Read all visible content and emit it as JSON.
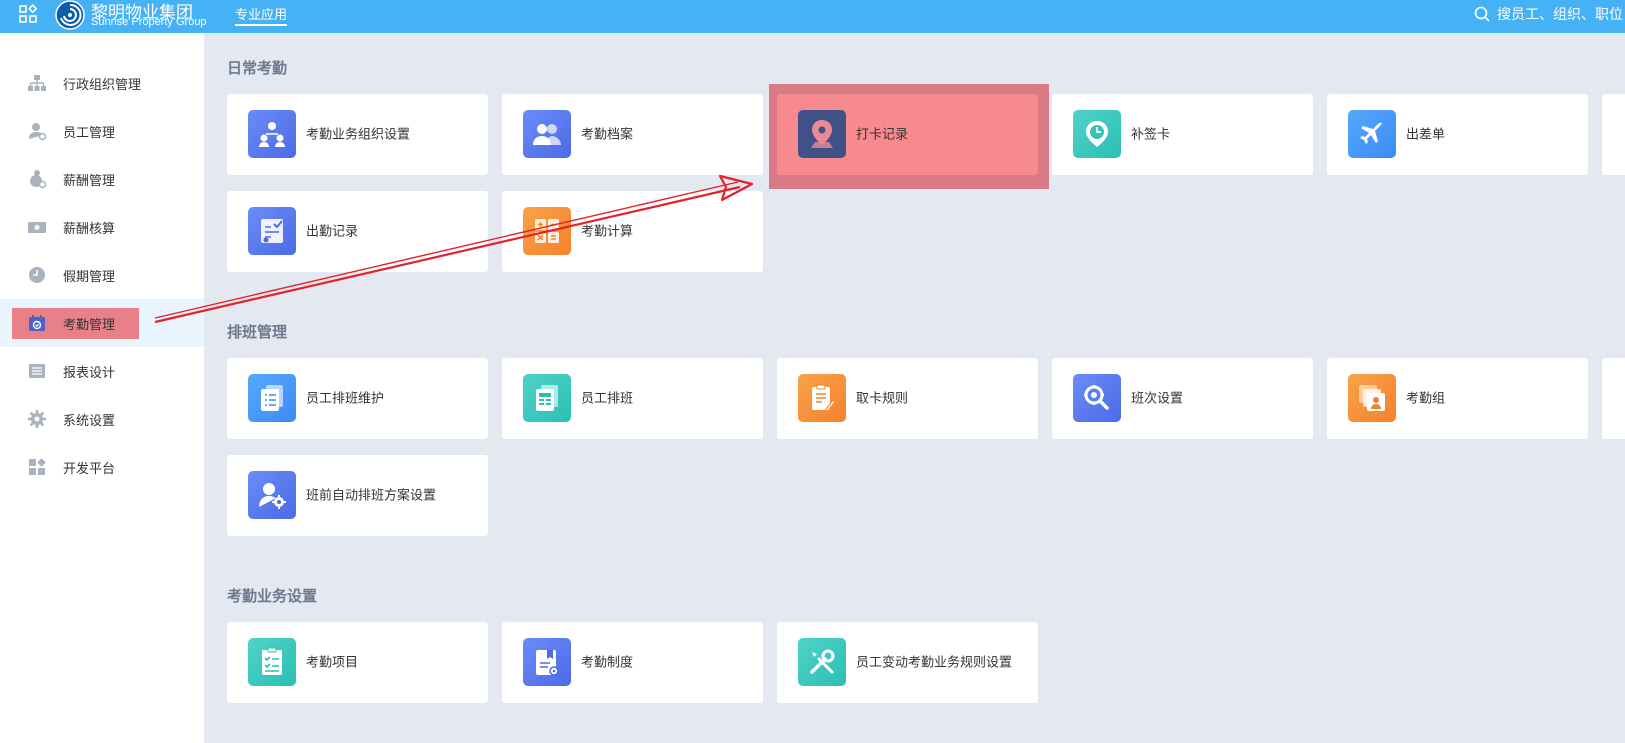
{
  "header": {
    "brand_cn": "黎明物业集团",
    "brand_en": "Sunrise Property Group",
    "nav_active": "专业应用",
    "search_placeholder": "搜员工、组织、职位"
  },
  "sidebar": {
    "items": [
      {
        "label": "行政组织管理",
        "icon": "org-tree-icon"
      },
      {
        "label": "员工管理",
        "icon": "user-gear-icon"
      },
      {
        "label": "薪酬管理",
        "icon": "money-bag-icon"
      },
      {
        "label": "薪酬核算",
        "icon": "cash-icon"
      },
      {
        "label": "假期管理",
        "icon": "clock-icon"
      },
      {
        "label": "考勤管理",
        "icon": "calendar-check-icon",
        "active": true
      },
      {
        "label": "报表设计",
        "icon": "report-icon"
      },
      {
        "label": "系统设置",
        "icon": "gear-icon"
      },
      {
        "label": "开发平台",
        "icon": "apps-icon"
      }
    ]
  },
  "sections": [
    {
      "title": "日常考勤",
      "cards": [
        {
          "label": "考勤业务组织设置",
          "icon": "org-people-icon",
          "color": "blue"
        },
        {
          "label": "考勤档案",
          "icon": "people-icon",
          "color": "blue"
        },
        {
          "label": "打卡记录",
          "icon": "map-pin-icon",
          "color": "navy",
          "highlighted": true
        },
        {
          "label": "补签卡",
          "icon": "clock-pin-icon",
          "color": "teal"
        },
        {
          "label": "出差单",
          "icon": "airplane-icon",
          "color": "sky"
        },
        {
          "label": "出勤记录",
          "icon": "route-check-icon",
          "color": "blue"
        },
        {
          "label": "考勤计算",
          "icon": "calculator-icon",
          "color": "orange"
        }
      ]
    },
    {
      "title": "排班管理",
      "cards": [
        {
          "label": "员工排班维护",
          "icon": "list-doc-icon",
          "color": "sky"
        },
        {
          "label": "员工排班",
          "icon": "table-doc-icon",
          "color": "teal"
        },
        {
          "label": "取卡规则",
          "icon": "clipboard-edit-icon",
          "color": "orange"
        },
        {
          "label": "班次设置",
          "icon": "search-gear-icon",
          "color": "blue"
        },
        {
          "label": "考勤组",
          "icon": "group-card-icon",
          "color": "orange"
        },
        {
          "label": "班前自动排班方案设置",
          "icon": "user-settings-icon",
          "color": "blue"
        }
      ]
    },
    {
      "title": "考勤业务设置",
      "cards": [
        {
          "label": "考勤项目",
          "icon": "checklist-icon",
          "color": "teal"
        },
        {
          "label": "考勤制度",
          "icon": "rule-book-icon",
          "color": "blue"
        },
        {
          "label": "员工变动考勤业务规则设置",
          "icon": "tools-icon",
          "color": "teal"
        }
      ]
    }
  ],
  "colors": {
    "topbar": "#45b2f5",
    "highlight": "#f68a8e",
    "annotation_arrow": "#e3222b"
  }
}
